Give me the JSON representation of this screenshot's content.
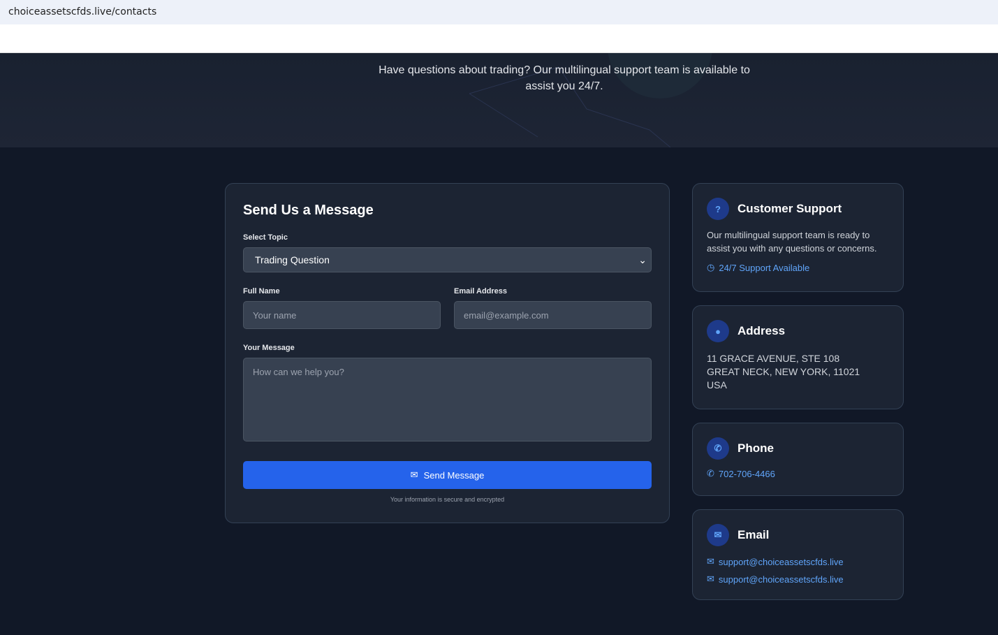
{
  "browser": {
    "url": "choiceassetscfds.live/contacts"
  },
  "hero": {
    "text": "Have questions about trading? Our multilingual support team is available to assist you 24/7."
  },
  "form": {
    "title": "Send Us a Message",
    "topic_label": "Select Topic",
    "topic_value": "Trading Question",
    "name_label": "Full Name",
    "name_placeholder": "Your name",
    "email_label": "Email Address",
    "email_placeholder": "email@example.com",
    "message_label": "Your Message",
    "message_placeholder": "How can we help you?",
    "submit": "Send Message",
    "note": "Your information is secure and encrypted"
  },
  "support": {
    "title": "Customer Support",
    "text": "Our multilingual support team is ready to assist you with any questions or concerns.",
    "availability": "24/7 Support Available"
  },
  "address": {
    "title": "Address",
    "line1": "11 GRACE AVENUE, STE 108",
    "line2": "GREAT NECK, NEW YORK, 11021",
    "line3": "USA"
  },
  "phone": {
    "title": "Phone",
    "number": "702-706-4466"
  },
  "email": {
    "title": "Email",
    "emails": [
      "support@choiceassetscfds.live",
      "support@choiceassetscfds.live"
    ]
  },
  "colors": {
    "accent": "#2563eb",
    "link": "#60a5fa",
    "bg": "#111827",
    "card": "#1c2433"
  }
}
